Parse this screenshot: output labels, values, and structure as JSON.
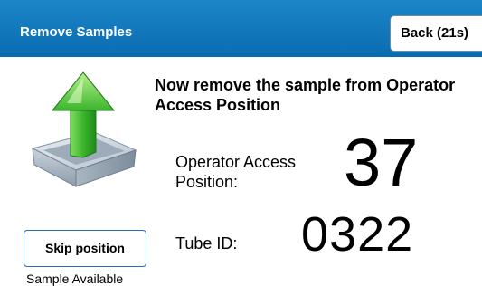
{
  "header": {
    "title": "Remove Samples",
    "back_label": "Back (21s)"
  },
  "instruction": "Now remove the sample from Operator Access Position",
  "position": {
    "label": "Operator Access Position:",
    "value": "37"
  },
  "tube": {
    "label": "Tube ID:",
    "value": "0322"
  },
  "actions": {
    "skip_label": "Skip position"
  },
  "status": "Sample Available",
  "icon": "tray-up-arrow-icon",
  "colors": {
    "header_bar": "#0a6cb0",
    "arrow_green": "#3cb52c",
    "button_border": "#2a6fb8"
  }
}
